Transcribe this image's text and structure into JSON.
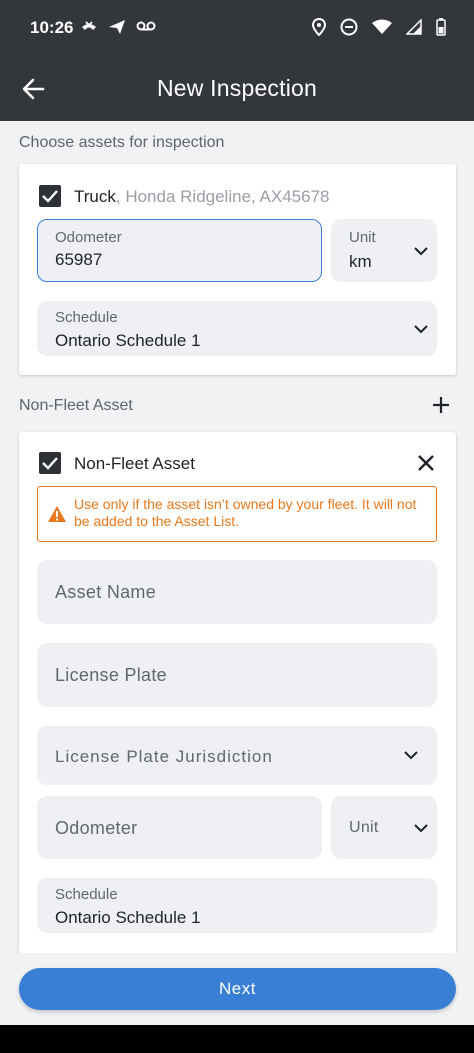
{
  "status_bar": {
    "time": "10:26"
  },
  "app_bar": {
    "title": "New Inspection"
  },
  "assets_section": {
    "label": "Choose assets for inspection",
    "asset": {
      "type": "Truck",
      "details": ", Honda Ridgeline, AX45678",
      "checked": true,
      "odometer_label": "Odometer",
      "odometer_value": "65987",
      "unit_label": "Unit",
      "unit_value": "km",
      "schedule_label": "Schedule",
      "schedule_value": "Ontario Schedule 1"
    }
  },
  "non_fleet_section": {
    "label": "Non-Fleet Asset",
    "card": {
      "title": "Non-Fleet Asset",
      "checked": true,
      "warning": "Use only if the asset isn’t owned by your fleet. It will not be added to the Asset List.",
      "asset_name_placeholder": "Asset Name",
      "license_plate_placeholder": "License Plate",
      "jurisdiction_placeholder": "License Plate Jurisdiction",
      "odometer_placeholder": "Odometer",
      "unit_placeholder": "Unit",
      "schedule_label": "Schedule",
      "schedule_value": "Ontario Schedule 1"
    }
  },
  "footer": {
    "next_label": "Next"
  },
  "colors": {
    "app_bar": "#33363b",
    "accent": "#3a7fd6",
    "warning": "#e8781d",
    "field_focus": "#3a7fd6"
  }
}
